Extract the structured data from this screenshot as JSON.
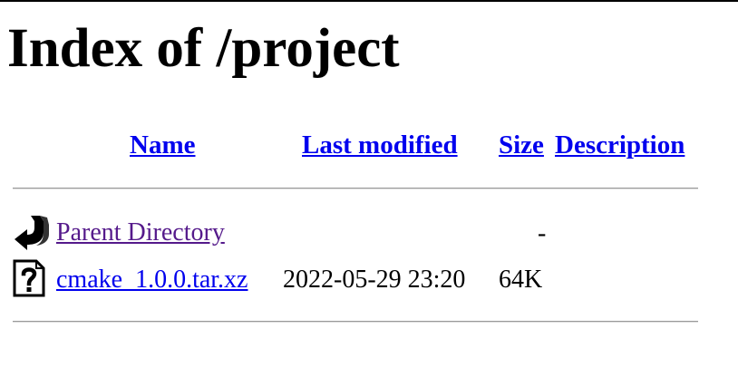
{
  "page": {
    "title": "Index of /project"
  },
  "columns": {
    "name": "Name",
    "last_modified": "Last modified",
    "size": "Size",
    "description": "Description"
  },
  "rows": [
    {
      "icon": "back-arrow-icon",
      "name": "Parent Directory",
      "last_modified": "",
      "size": "-",
      "description": ""
    },
    {
      "icon": "unknown-file-icon",
      "name": "cmake_1.0.0.tar.xz",
      "last_modified": "2022-05-29 23:20",
      "size": "64K",
      "description": ""
    }
  ],
  "colors": {
    "link": "#0000ee",
    "visited_link": "#551a8b",
    "rule": "#9a9a9a"
  }
}
